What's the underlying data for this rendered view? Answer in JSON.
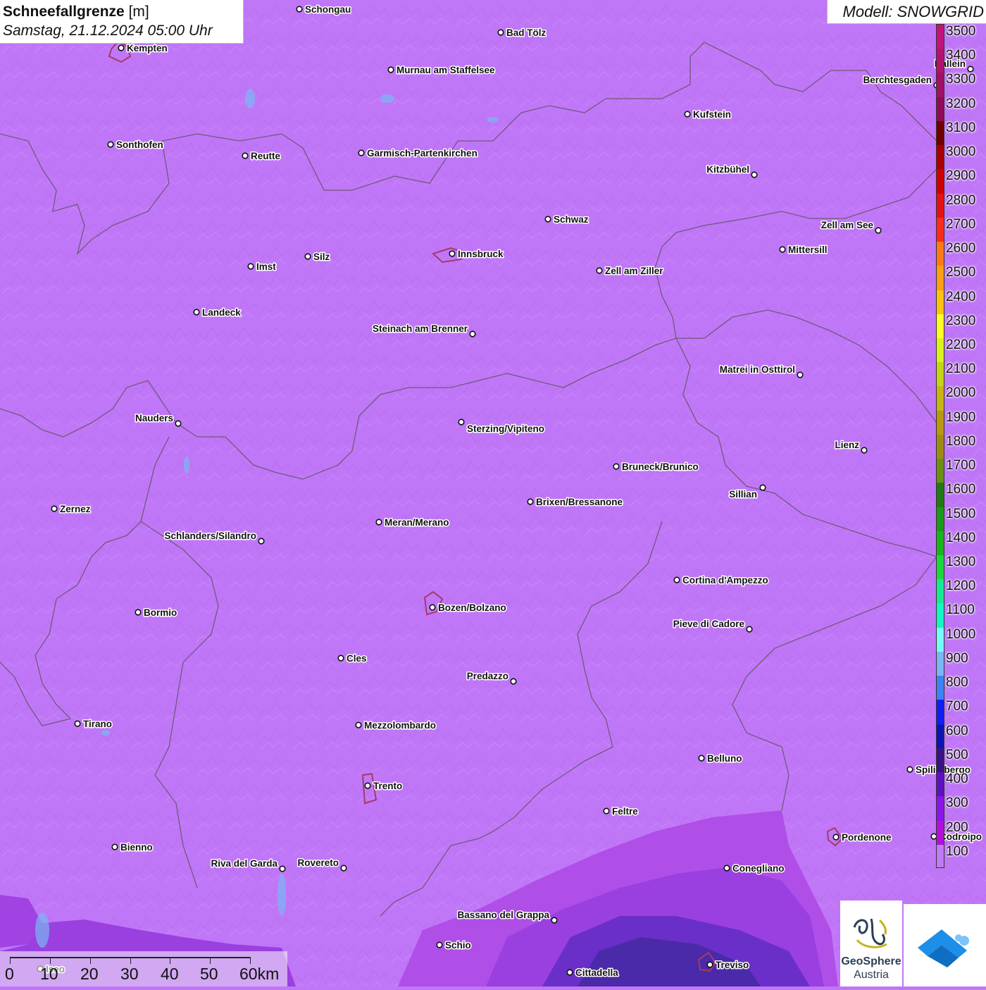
{
  "header": {
    "title_bold": "Schneefallgrenze",
    "title_unit": "[m]",
    "datetime": "Samstag, 21.12.2024 05:00 Uhr"
  },
  "model_label": "Modell: SNOWGRID",
  "legend": {
    "levels": [
      {
        "label": "3500",
        "color": "#c2137a"
      },
      {
        "label": "3400",
        "color": "#b3126f"
      },
      {
        "label": "3300",
        "color": "#a21064"
      },
      {
        "label": "3200",
        "color": "#8e0c55"
      },
      {
        "label": "3100",
        "color": "#6e0000"
      },
      {
        "label": "3000",
        "color": "#a80000"
      },
      {
        "label": "2900",
        "color": "#d10000"
      },
      {
        "label": "2800",
        "color": "#e81010"
      },
      {
        "label": "2700",
        "color": "#ff2a1a"
      },
      {
        "label": "2600",
        "color": "#ff7a14"
      },
      {
        "label": "2500",
        "color": "#ff9d10"
      },
      {
        "label": "2400",
        "color": "#ffc20e"
      },
      {
        "label": "2300",
        "color": "#ffff20"
      },
      {
        "label": "2200",
        "color": "#d9f21c"
      },
      {
        "label": "2100",
        "color": "#c5d514"
      },
      {
        "label": "2000",
        "color": "#c7b510"
      },
      {
        "label": "1900",
        "color": "#b99710"
      },
      {
        "label": "1800",
        "color": "#9c8c12"
      },
      {
        "label": "1700",
        "color": "#6b8f12"
      },
      {
        "label": "1600",
        "color": "#1f7a12"
      },
      {
        "label": "1500",
        "color": "#1a9a18"
      },
      {
        "label": "1400",
        "color": "#18b41c"
      },
      {
        "label": "1300",
        "color": "#1ad83a"
      },
      {
        "label": "1200",
        "color": "#14ea92"
      },
      {
        "label": "1100",
        "color": "#12f7c2"
      },
      {
        "label": "1000",
        "color": "#76fbfb"
      },
      {
        "label": "900",
        "color": "#7ab6f2"
      },
      {
        "label": "800",
        "color": "#3b84f2"
      },
      {
        "label": "700",
        "color": "#0f1ef2"
      },
      {
        "label": "600",
        "color": "#0a14b2"
      },
      {
        "label": "500",
        "color": "#3a1282"
      },
      {
        "label": "400",
        "color": "#5c12be"
      },
      {
        "label": "300",
        "color": "#8a14ea"
      },
      {
        "label": "200",
        "color": "#b110d8"
      },
      {
        "label": "100",
        "color": "#c17bf5"
      }
    ]
  },
  "map": {
    "base_color": "#c077f7",
    "border_color": "#6e5a78",
    "cities": [
      {
        "name": "Schongau"
      },
      {
        "name": "Bad Tölz"
      },
      {
        "name": "Kempten"
      },
      {
        "name": "Murnau am Staffelsee"
      },
      {
        "name": "Berchtesgaden"
      },
      {
        "name": "Hallein"
      },
      {
        "name": "Kufstein"
      },
      {
        "name": "Sonthofen"
      },
      {
        "name": "Reutte"
      },
      {
        "name": "Garmisch-Partenkirchen"
      },
      {
        "name": "Kitzbühel"
      },
      {
        "name": "Schwaz"
      },
      {
        "name": "Zell am See"
      },
      {
        "name": "Innsbruck"
      },
      {
        "name": "Mittersill"
      },
      {
        "name": "Imst"
      },
      {
        "name": "Silz"
      },
      {
        "name": "Zell am Ziller"
      },
      {
        "name": "Landeck"
      },
      {
        "name": "Steinach am Brenner"
      },
      {
        "name": "Matrei in Osttirol"
      },
      {
        "name": "Nauders"
      },
      {
        "name": "Sterzing/Vipiteno"
      },
      {
        "name": "Lienz"
      },
      {
        "name": "Bruneck/Brunico"
      },
      {
        "name": "Sillian"
      },
      {
        "name": "Zernez"
      },
      {
        "name": "Brixen/Bressanone"
      },
      {
        "name": "Meran/Merano"
      },
      {
        "name": "Schlanders/Silandro"
      },
      {
        "name": "Cortina d'Ampezzo"
      },
      {
        "name": "Bozen/Bolzano"
      },
      {
        "name": "Bormio"
      },
      {
        "name": "Pieve di Cadore"
      },
      {
        "name": "Cles"
      },
      {
        "name": "Predazzo"
      },
      {
        "name": "Tirano"
      },
      {
        "name": "Mezzolombardo"
      },
      {
        "name": "Belluno"
      },
      {
        "name": "Spilimbergo"
      },
      {
        "name": "Trento"
      },
      {
        "name": "Feltre"
      },
      {
        "name": "Pordenone"
      },
      {
        "name": "Codroipo"
      },
      {
        "name": "Bienno"
      },
      {
        "name": "Riva del Garda"
      },
      {
        "name": "Rovereto"
      },
      {
        "name": "Conegliano"
      },
      {
        "name": "Bassano del Grappa"
      },
      {
        "name": "Schio"
      },
      {
        "name": "Iseo"
      },
      {
        "name": "Cittadella"
      },
      {
        "name": "Treviso"
      }
    ]
  },
  "scale": {
    "labels": [
      "0",
      "10",
      "20",
      "30",
      "40",
      "50",
      "60km"
    ]
  },
  "logos": {
    "geosphere_line1": "GeoSphere",
    "geosphere_line2": "Austria"
  }
}
